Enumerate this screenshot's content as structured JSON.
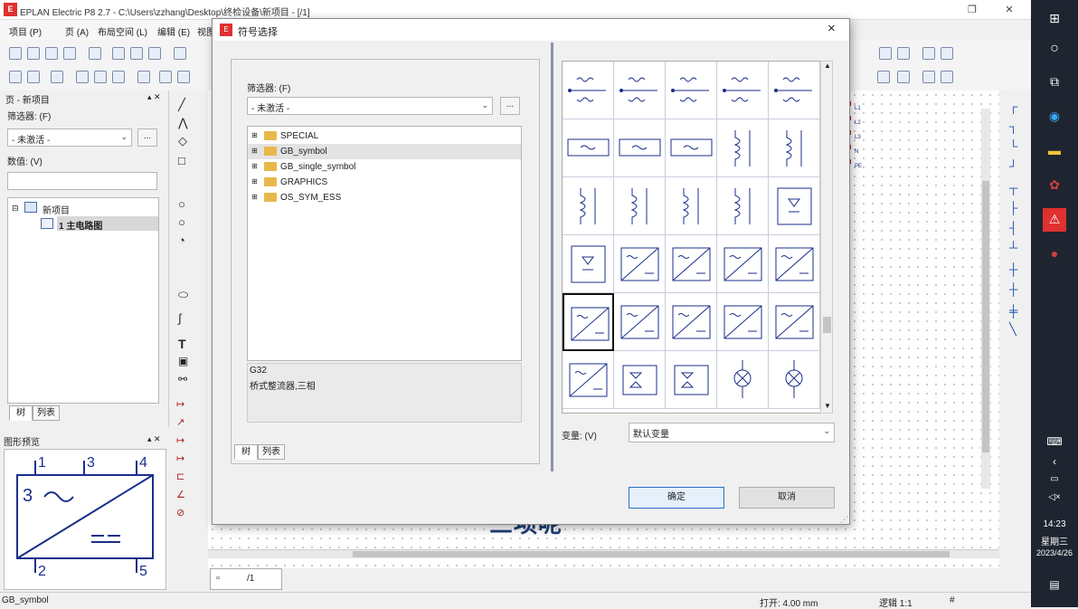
{
  "app": {
    "title": "EPLAN Electric P8 2.7 - C:\\Users\\zzhang\\Desktop\\终检设备\\新项目 - [/1]",
    "logo_text": "E"
  },
  "menu": [
    {
      "label": "项目 (P)"
    },
    {
      "label": "页 (A)"
    },
    {
      "label": "布局空间 (L)"
    },
    {
      "label": "编辑 (E)"
    },
    {
      "label": "视图"
    }
  ],
  "left_panel": {
    "title": "页 - 新项目",
    "filter_label": "筛选器: (F)",
    "filter_value": "- 未激活 -",
    "browse_label": "...",
    "value_label": "数值: (V)",
    "value_input": "",
    "tree": [
      {
        "label": "新项目",
        "level": 0
      },
      {
        "label": "1 主电路图",
        "level": 1
      }
    ],
    "tabs": [
      "树",
      "列表"
    ]
  },
  "preview": {
    "title": "图形预览",
    "pins": [
      "1",
      "3",
      "4",
      "2",
      "5"
    ],
    "symbol_number": "3"
  },
  "dialog": {
    "title": "符号选择",
    "close": "×",
    "filter_label": "筛选器: (F)",
    "filter_value": "- 未激活 -",
    "browse_label": "...",
    "tree_items": [
      {
        "label": "SPECIAL",
        "selected": false
      },
      {
        "label": "GB_symbol",
        "selected": true
      },
      {
        "label": "GB_single_symbol",
        "selected": false
      },
      {
        "label": "GRAPHICS",
        "selected": false
      },
      {
        "label": "OS_SYM_ESS",
        "selected": false
      }
    ],
    "description_code": "G32",
    "description_text": "桥式整流器,三相",
    "tabs": [
      "树",
      "列表"
    ],
    "variant_label": "变量: (V)",
    "variant_value": "默认变量",
    "ok_label": "确定",
    "cancel_label": "取消"
  },
  "drawing": {
    "page_tab": "/1",
    "bus_labels": [
      "L1",
      "L2",
      "L3",
      "N",
      "PE"
    ]
  },
  "subtitle": "三项呢",
  "statusbar": {
    "left": "GB_symbol",
    "grid": "打开: 4.00 mm",
    "logic": "逻辑 1:1",
    "hash": "#"
  },
  "taskbar": {
    "time": "14:23",
    "weekday": "星期三",
    "date": "2023/4/26"
  },
  "colors": {
    "symbol_blue": "#1a2f8a",
    "selection": "#cfe3f7"
  }
}
